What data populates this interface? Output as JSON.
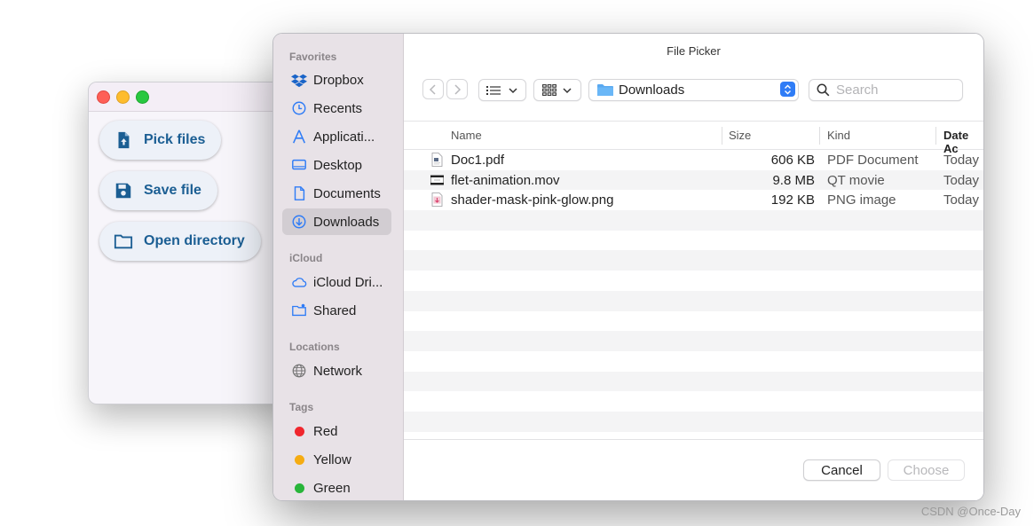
{
  "app": {
    "buttons": [
      {
        "label": "Pick files",
        "icon": "upload-file-icon"
      },
      {
        "label": "Save file",
        "icon": "floppy-disk-icon"
      },
      {
        "label": "Open directory",
        "icon": "folder-icon"
      }
    ]
  },
  "dialog": {
    "title": "File Picker",
    "sidebar": {
      "favorites_header": "Favorites",
      "favorites": [
        {
          "label": "Dropbox",
          "icon": "dropbox-icon"
        },
        {
          "label": "Recents",
          "icon": "clock-icon"
        },
        {
          "label": "Applicati...",
          "icon": "applications-icon"
        },
        {
          "label": "Desktop",
          "icon": "desktop-icon"
        },
        {
          "label": "Documents",
          "icon": "document-icon"
        },
        {
          "label": "Downloads",
          "icon": "download-icon",
          "selected": true
        }
      ],
      "icloud_header": "iCloud",
      "icloud": [
        {
          "label": "iCloud Dri...",
          "icon": "cloud-icon"
        },
        {
          "label": "Shared",
          "icon": "shared-folder-icon"
        }
      ],
      "locations_header": "Locations",
      "locations": [
        {
          "label": "Network",
          "icon": "globe-icon"
        }
      ],
      "tags_header": "Tags",
      "tags": [
        {
          "label": "Red",
          "color": "#f0262d"
        },
        {
          "label": "Yellow",
          "color": "#f5ac12"
        },
        {
          "label": "Green",
          "color": "#28b53a"
        }
      ]
    },
    "toolbar": {
      "location": "Downloads",
      "search_placeholder": "Search"
    },
    "columns": {
      "name": "Name",
      "size": "Size",
      "kind": "Kind",
      "date": "Date Ac"
    },
    "files": [
      {
        "name": "Doc1.pdf",
        "size": "606 KB",
        "kind": "PDF Document",
        "date": "Today",
        "icon": "pdf-file-icon"
      },
      {
        "name": "flet-animation.mov",
        "size": "9.8 MB",
        "kind": "QT movie",
        "date": "Today",
        "icon": "movie-file-icon"
      },
      {
        "name": "shader-mask-pink-glow.png",
        "size": "192 KB",
        "kind": "PNG image",
        "date": "Today",
        "icon": "image-file-icon"
      }
    ],
    "footer": {
      "cancel": "Cancel",
      "choose": "Choose"
    }
  },
  "watermark": "CSDN @Once-Day",
  "colors": {
    "accent": "#2f7cf6",
    "app_button_text": "#1b5e93",
    "sidebar_bg": "#e8e2e7"
  }
}
